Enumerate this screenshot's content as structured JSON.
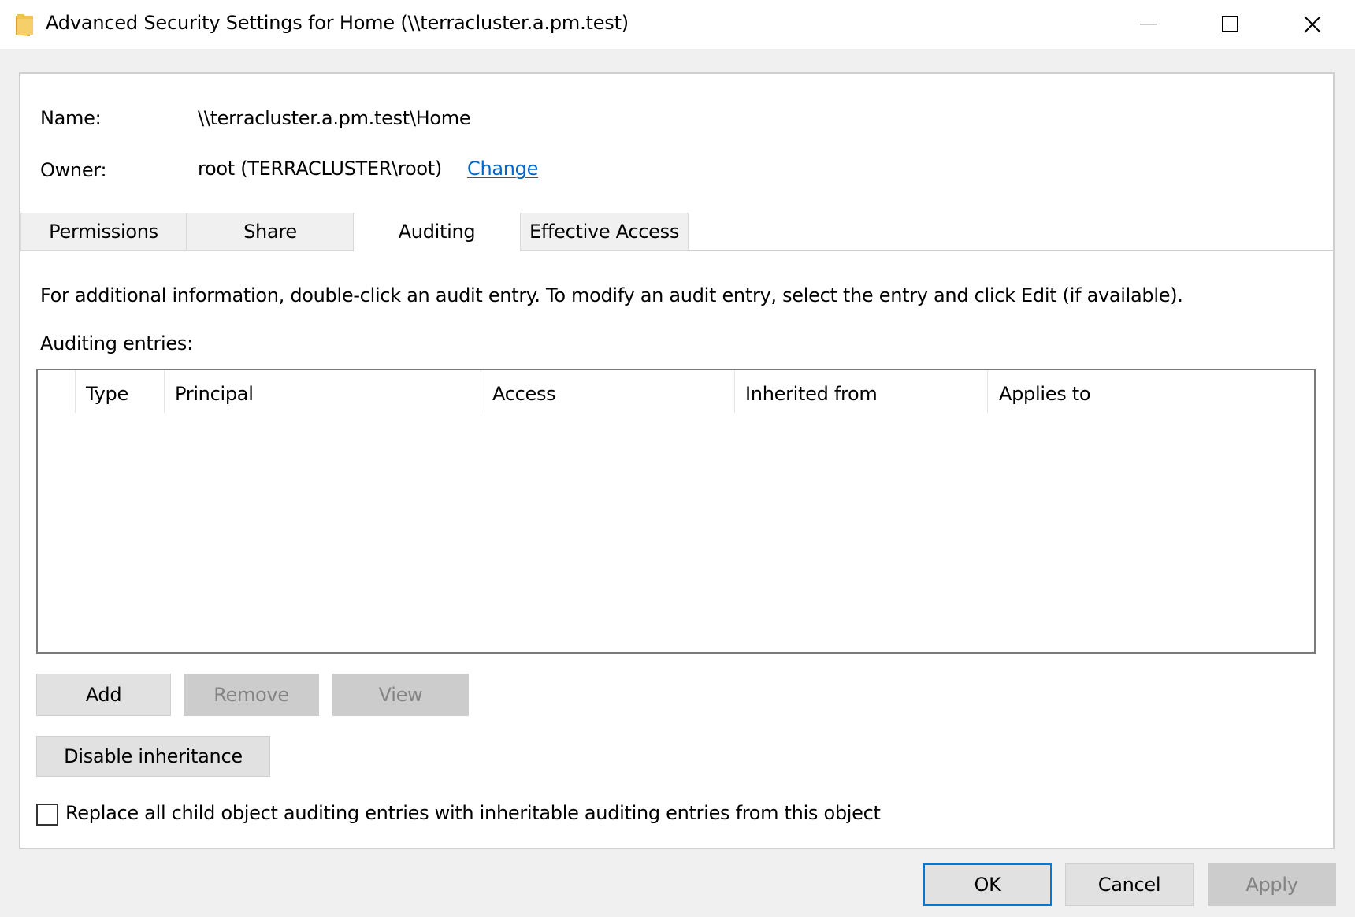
{
  "window": {
    "title": "Advanced Security Settings for Home (\\\\terracluster.a.pm.test)",
    "controls": {
      "minimize": "minimize",
      "maximize": "maximize",
      "close": "close"
    }
  },
  "info": {
    "name_label": "Name:",
    "name_value": "\\\\terracluster.a.pm.test\\Home",
    "owner_label": "Owner:",
    "owner_value": "root (TERRACLUSTER\\root)",
    "change_link": "Change"
  },
  "tabs": [
    {
      "label": "Permissions",
      "active": false
    },
    {
      "label": "Share",
      "active": false
    },
    {
      "label": "Auditing",
      "active": true
    },
    {
      "label": "Effective Access",
      "active": false
    }
  ],
  "auditing": {
    "info_text": "For additional information, double-click an audit entry. To modify an audit entry, select the entry and click Edit (if available).",
    "entries_label": "Auditing entries:",
    "columns": [
      "",
      "Type",
      "Principal",
      "Access",
      "Inherited from",
      "Applies to"
    ],
    "rows": []
  },
  "buttons": {
    "add": "Add",
    "remove": "Remove",
    "view": "View",
    "disable_inheritance": "Disable inheritance",
    "ok": "OK",
    "cancel": "Cancel",
    "apply": "Apply"
  },
  "replace_checkbox": {
    "label": "Replace all child object auditing entries with inheritable auditing entries from this object",
    "checked": false
  },
  "colors": {
    "link": "#0066cc",
    "default_button_border": "#0078d7",
    "folder_icon": "#f0c34e"
  }
}
